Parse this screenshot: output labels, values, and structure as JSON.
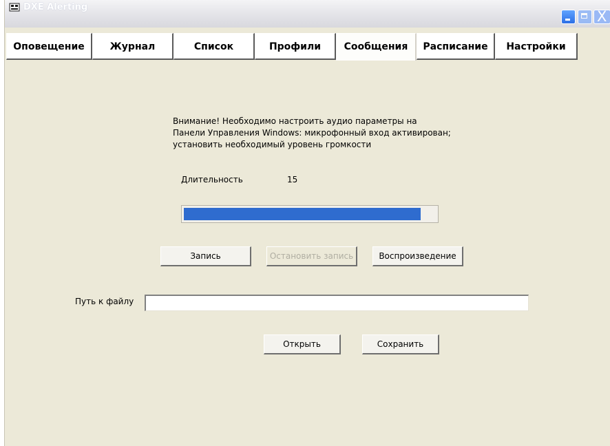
{
  "window": {
    "title": "DXE Alerting",
    "close_glyph": "X"
  },
  "tabs": [
    {
      "label": "Оповещение"
    },
    {
      "label": "Журнал"
    },
    {
      "label": "Список"
    },
    {
      "label": "Профили"
    },
    {
      "label": "Сообщения",
      "active": true
    },
    {
      "label": "Расписание"
    },
    {
      "label": "Настройки"
    }
  ],
  "messages": {
    "notice_lines": [
      "Внимание! Необходимо настроить аудио параметры на",
      "Панели Управления Windows: микрофонный вход активирован;",
      "установить необходимый уровень громкости"
    ],
    "duration_label": "Длительность",
    "duration_value": "15",
    "progress_fraction": 0.94,
    "record_button": "Запись",
    "stop_button": "Остановить запись",
    "stop_button_disabled": true,
    "play_button": "Воспроизведение",
    "path_label": "Путь к файлу",
    "path_value": "",
    "open_button": "Открыть",
    "save_button": "Сохранить"
  },
  "colors": {
    "progress_fill": "#2f6ccf",
    "window_bg": "#ece9d8"
  },
  "icons": {
    "app": "dxe-app-icon",
    "minimize": "minimize-icon",
    "maximize": "maximize-icon",
    "close": "close-icon"
  }
}
